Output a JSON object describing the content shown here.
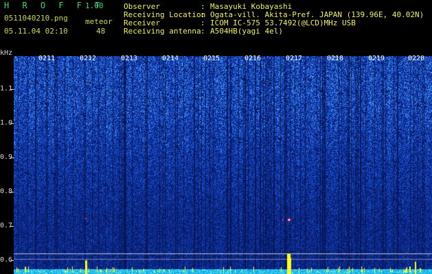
{
  "header": {
    "app_title": "H R O F F T",
    "version": "1.00",
    "filename": "0511040210.png",
    "datetime": "05.11.04 02:10",
    "count_label": "meteor",
    "count_value": "48"
  },
  "info": [
    {
      "label": "Observer",
      "value": "Masayuki Kobayashi"
    },
    {
      "label": "Receiving Location",
      "value": "Ogata-vill. Akita-Pref. JAPAN (139.96E, 40.02N)"
    },
    {
      "label": "Receiver",
      "value": "ICOM IC-575 53.7492(@LCD)MHz USB"
    },
    {
      "label": "Receiving antenna",
      "value": "A504HB(yagi 4el)"
    }
  ],
  "y_axis": {
    "unit": "kHz",
    "ticks": [
      "1.1",
      "1.0",
      "0.9",
      "0.8",
      "0.7",
      "0.6"
    ]
  },
  "time_labels": [
    "0211",
    "0212",
    "0213",
    "0214",
    "0215",
    "0216",
    "0217",
    "0218",
    "0219",
    "0220"
  ],
  "colors": {
    "background": "#000000",
    "spectrum_base": "#1540a8",
    "noise_light": "#4fa0ff",
    "noise_bright": "#60ffd0",
    "echo_red": "#ff3030",
    "marker": "#ffff20",
    "text_green": "#3ed67a",
    "text_yellow": "#f0f060"
  }
}
